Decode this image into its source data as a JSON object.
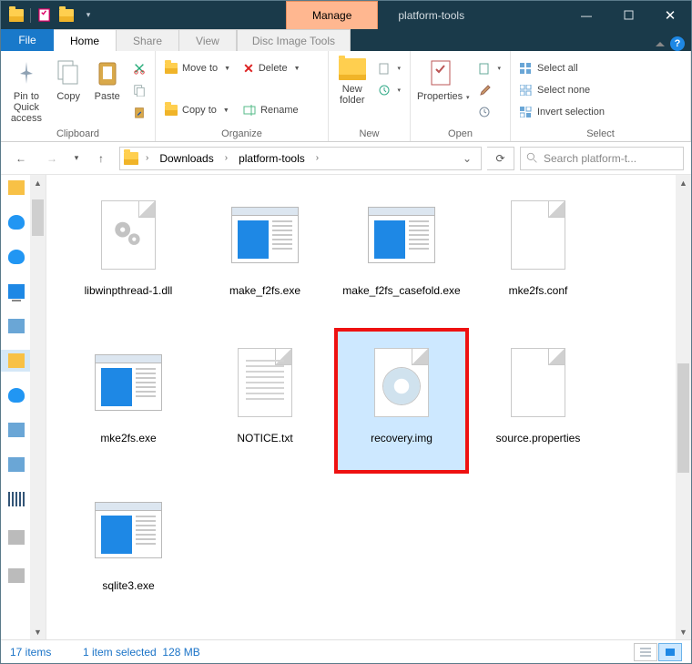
{
  "titlebar": {
    "context_tab": "Manage",
    "window_title": "platform-tools"
  },
  "tabs": {
    "file": "File",
    "home": "Home",
    "share": "Share",
    "view": "View",
    "context": "Disc Image Tools"
  },
  "ribbon": {
    "clipboard": {
      "label": "Clipboard",
      "pin": "Pin to Quick access",
      "copy": "Copy",
      "paste": "Paste"
    },
    "organize": {
      "label": "Organize",
      "move": "Move to",
      "copy": "Copy to",
      "delete": "Delete",
      "rename": "Rename"
    },
    "new": {
      "label": "New",
      "folder": "New folder"
    },
    "open": {
      "label": "Open",
      "properties": "Properties"
    },
    "select": {
      "label": "Select",
      "all": "Select all",
      "none": "Select none",
      "invert": "Invert selection"
    }
  },
  "breadcrumb": {
    "seg1": "Downloads",
    "seg2": "platform-tools"
  },
  "search": {
    "placeholder": "Search platform-t..."
  },
  "files": {
    "items": [
      {
        "name": "libwinpthread-1.dll",
        "kind": "dll"
      },
      {
        "name": "make_f2fs.exe",
        "kind": "exe"
      },
      {
        "name": "make_f2fs_casefold.exe",
        "kind": "exe"
      },
      {
        "name": "mke2fs.conf",
        "kind": "blank"
      },
      {
        "name": "mke2fs.exe",
        "kind": "exe"
      },
      {
        "name": "NOTICE.txt",
        "kind": "txt"
      },
      {
        "name": "recovery.img",
        "kind": "img",
        "selected": true,
        "highlighted": true
      },
      {
        "name": "source.properties",
        "kind": "blank"
      },
      {
        "name": "sqlite3.exe",
        "kind": "exe"
      }
    ]
  },
  "status": {
    "count": "17 items",
    "selection": "1 item selected",
    "size": "128 MB"
  }
}
